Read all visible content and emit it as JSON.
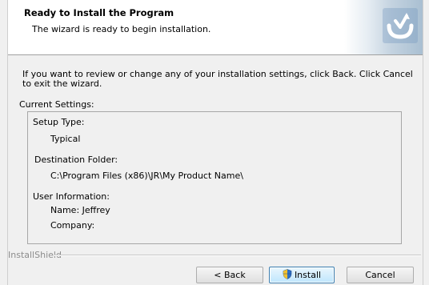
{
  "header": {
    "title": "Ready to Install the Program",
    "subtitle": "The wizard is ready to begin installation."
  },
  "intro_text": "If you want to review or change any of your installation settings, click Back. Click Cancel to exit the wizard.",
  "current_settings_label": "Current Settings:",
  "settings": {
    "setup_type_label": "Setup Type:",
    "setup_type_value": "Typical",
    "destination_label": "Destination Folder:",
    "destination_value": "C:\\Program Files (x86)\\JR\\My Product Name\\",
    "user_info_label": "User Information:",
    "name_line": "Name: Jeffrey",
    "company_line": "Company:"
  },
  "branding": "InstallShield",
  "buttons": {
    "back": "< Back",
    "install": "Install",
    "cancel": "Cancel"
  },
  "colors": {
    "accent_logo": "#5a87b6",
    "install_border": "#3c7fb1"
  }
}
